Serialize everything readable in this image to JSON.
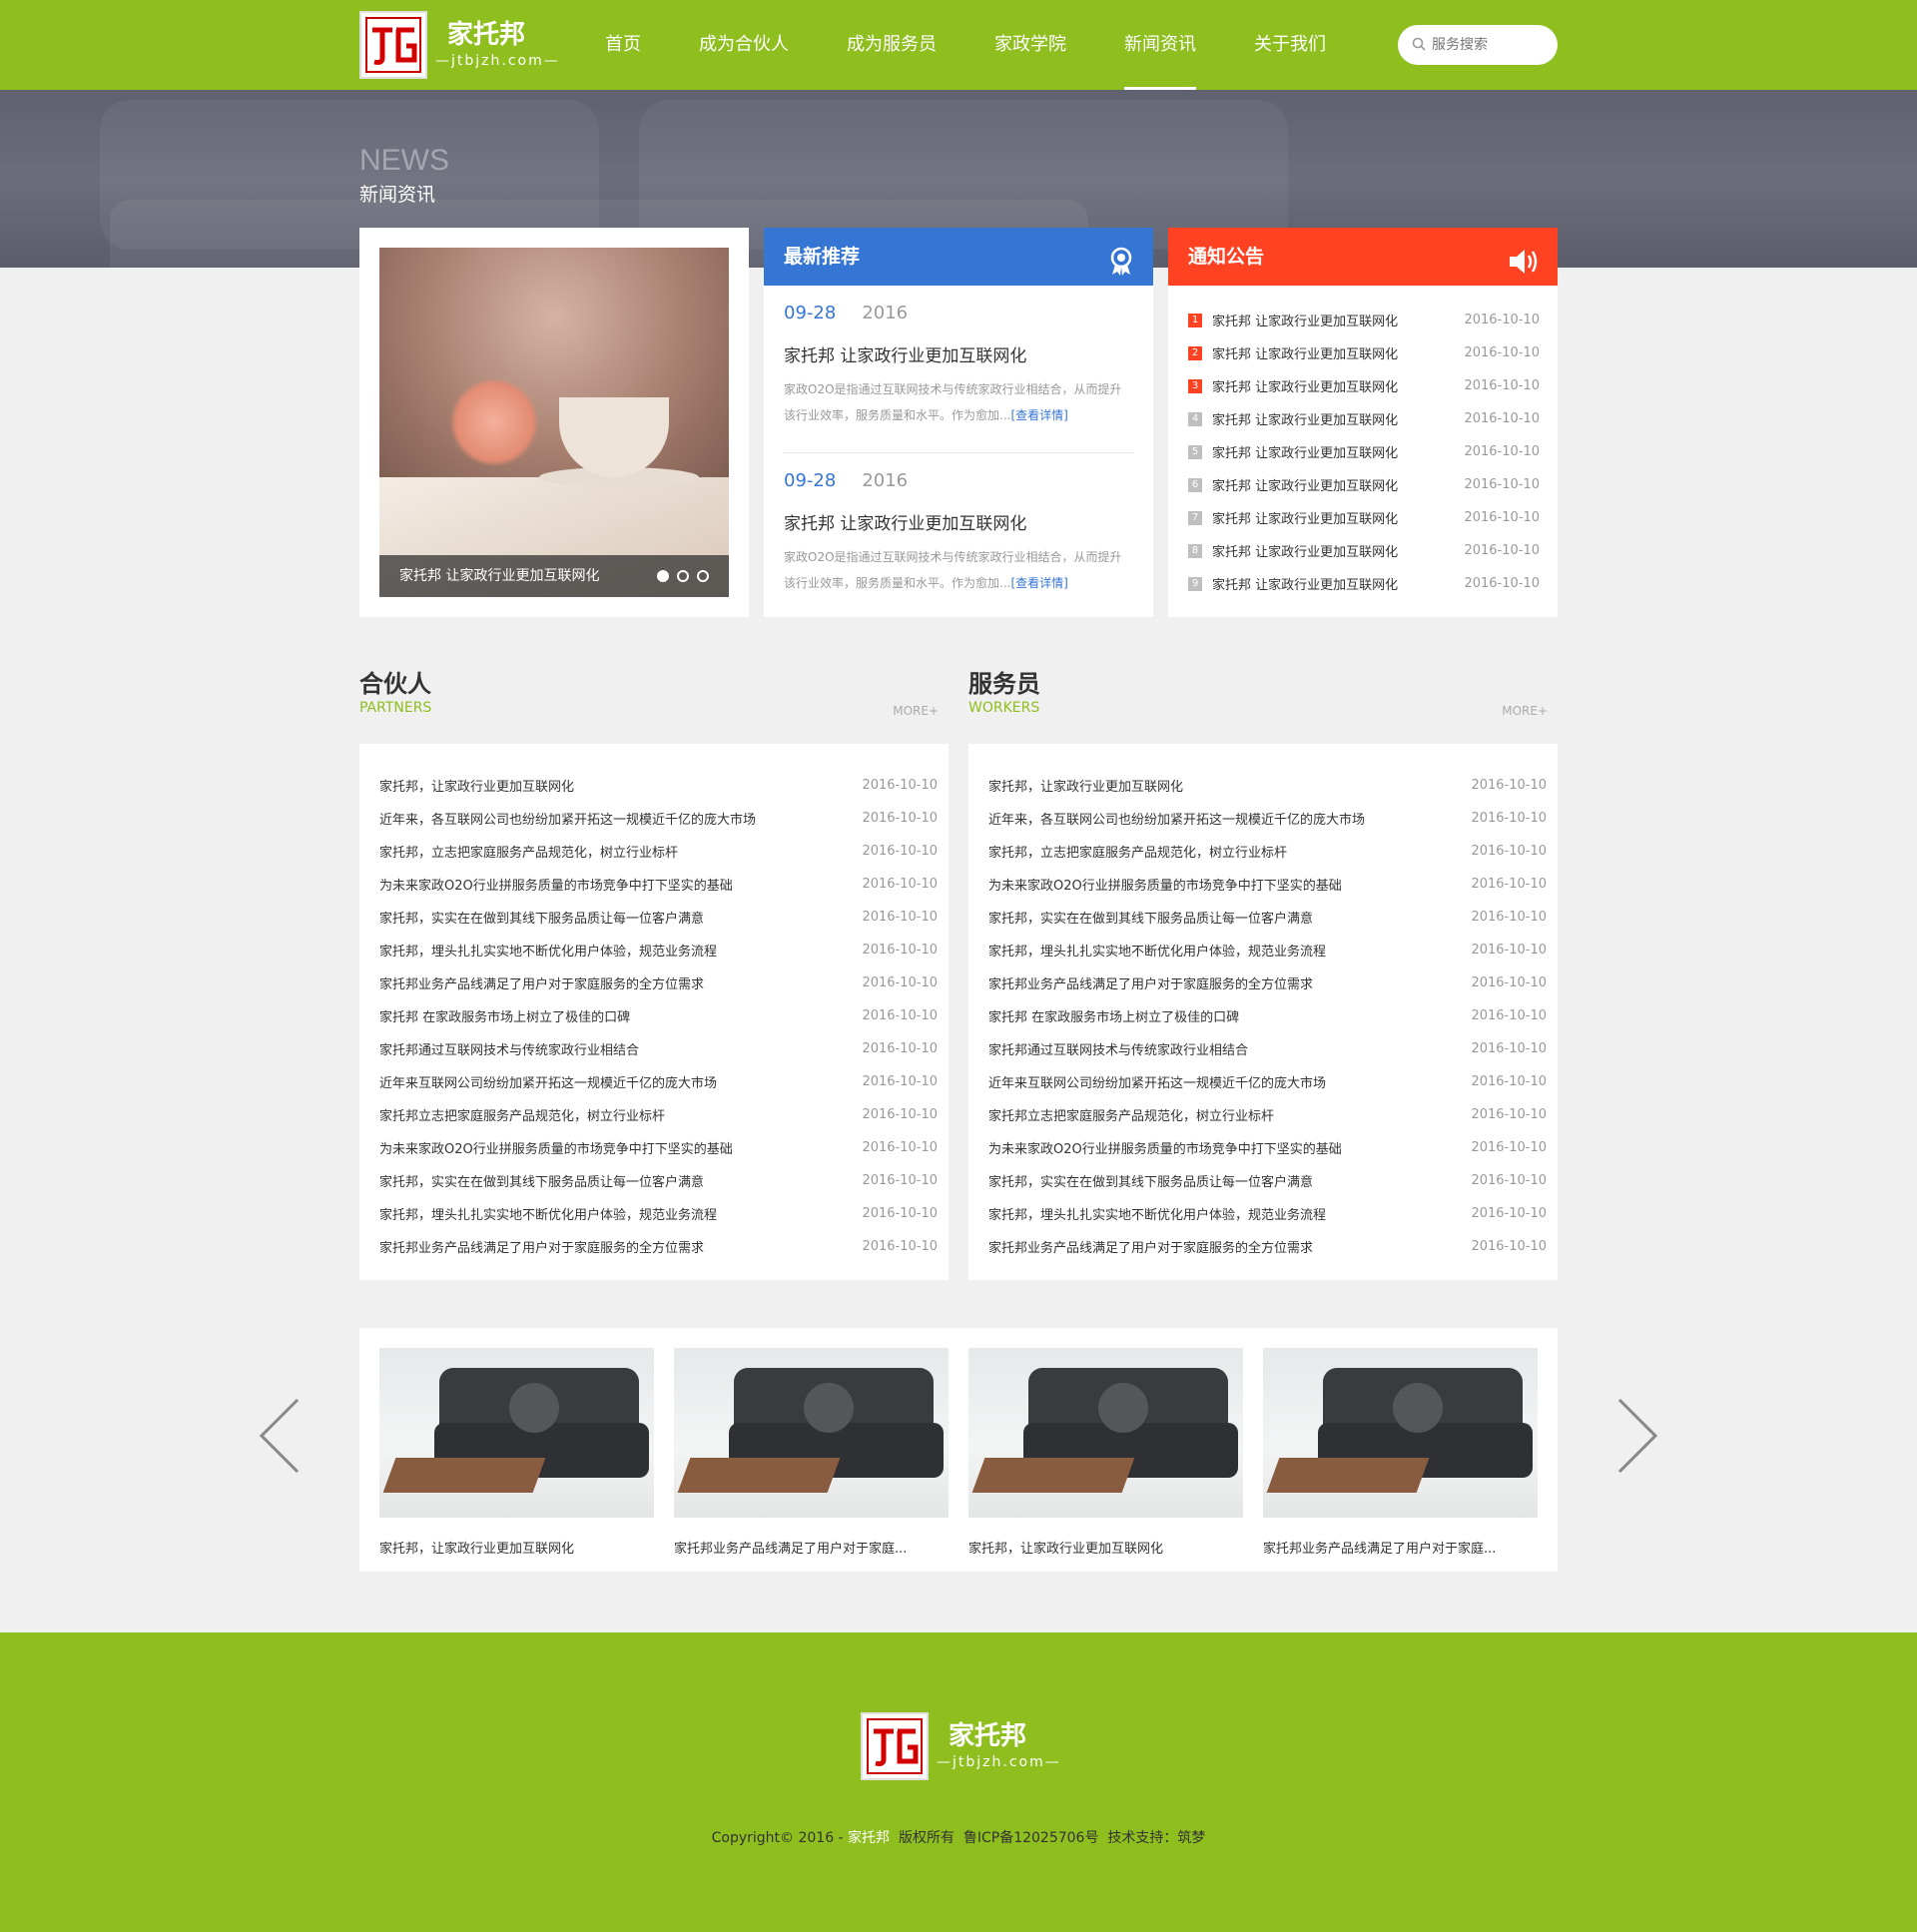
{
  "colors": {
    "green": "#8fbe1f",
    "blue": "#3575d3",
    "red": "#ff4322"
  },
  "brand": {
    "name": "家托邦",
    "domain": "—jtbjzh.com—"
  },
  "nav": {
    "items": [
      "首页",
      "成为合伙人",
      "成为服务员",
      "家政学院",
      "新闻资讯",
      "关于我们"
    ],
    "active": "新闻资讯"
  },
  "search": {
    "placeholder": "服务搜索",
    "icon": "search-icon"
  },
  "banner": {
    "en": "NEWS",
    "cn": "新闻资讯"
  },
  "slider": {
    "caption": "家托邦 让家政行业更加互联网化",
    "slides": 3,
    "active": 1
  },
  "latest": {
    "title": "最新推荐",
    "icon": "award-ribbon-icon",
    "items": [
      {
        "md": "09-28",
        "year": "2016",
        "title": "家托邦 让家政行业更加互联网化",
        "desc": "家政O2O是指通过互联网技术与传统家政行业相结合，从而提升该行业效率，服务质量和水平。作为愈加...",
        "more": "[查看详情]"
      },
      {
        "md": "09-28",
        "year": "2016",
        "title": "家托邦 让家政行业更加互联网化",
        "desc": "家政O2O是指通过互联网技术与传统家政行业相结合，从而提升该行业效率，服务质量和水平。作为愈加...",
        "more": "[查看详情]"
      }
    ]
  },
  "notice": {
    "title": "通知公告",
    "icon": "speaker-icon",
    "items": [
      {
        "n": "1",
        "title": "家托邦 让家政行业更加互联网化",
        "date": "2016-10-10"
      },
      {
        "n": "2",
        "title": "家托邦 让家政行业更加互联网化",
        "date": "2016-10-10"
      },
      {
        "n": "3",
        "title": "家托邦 让家政行业更加互联网化",
        "date": "2016-10-10"
      },
      {
        "n": "4",
        "title": "家托邦 让家政行业更加互联网化",
        "date": "2016-10-10"
      },
      {
        "n": "5",
        "title": "家托邦 让家政行业更加互联网化",
        "date": "2016-10-10"
      },
      {
        "n": "6",
        "title": "家托邦 让家政行业更加互联网化",
        "date": "2016-10-10"
      },
      {
        "n": "7",
        "title": "家托邦 让家政行业更加互联网化",
        "date": "2016-10-10"
      },
      {
        "n": "8",
        "title": "家托邦 让家政行业更加互联网化",
        "date": "2016-10-10"
      },
      {
        "n": "9",
        "title": "家托邦 让家政行业更加互联网化",
        "date": "2016-10-10"
      }
    ]
  },
  "partners": {
    "title": "合伙人",
    "en": "PARTNERS",
    "more": "MORE+",
    "items": [
      {
        "title": "家托邦，让家政行业更加互联网化",
        "date": "2016-10-10"
      },
      {
        "title": "近年来，各互联网公司也纷纷加紧开拓这一规模近千亿的庞大市场",
        "date": "2016-10-10"
      },
      {
        "title": "家托邦，立志把家庭服务产品规范化，树立行业标杆",
        "date": "2016-10-10"
      },
      {
        "title": "为未来家政O2O行业拼服务质量的市场竞争中打下坚实的基础",
        "date": "2016-10-10"
      },
      {
        "title": "家托邦，实实在在做到其线下服务品质让每一位客户满意",
        "date": "2016-10-10"
      },
      {
        "title": "家托邦，埋头扎扎实实地不断优化用户体验，规范业务流程",
        "date": "2016-10-10"
      },
      {
        "title": "家托邦业务产品线满足了用户对于家庭服务的全方位需求",
        "date": "2016-10-10"
      },
      {
        "title": "家托邦 在家政服务市场上树立了极佳的口碑",
        "date": "2016-10-10"
      },
      {
        "title": "家托邦通过互联网技术与传统家政行业相结合",
        "date": "2016-10-10"
      },
      {
        "title": "近年来互联网公司纷纷加紧开拓这一规模近千亿的庞大市场",
        "date": "2016-10-10"
      },
      {
        "title": "家托邦立志把家庭服务产品规范化，树立行业标杆",
        "date": "2016-10-10"
      },
      {
        "title": "为未来家政O2O行业拼服务质量的市场竞争中打下坚实的基础",
        "date": "2016-10-10"
      },
      {
        "title": "家托邦，实实在在做到其线下服务品质让每一位客户满意",
        "date": "2016-10-10"
      },
      {
        "title": "家托邦，埋头扎扎实实地不断优化用户体验，规范业务流程",
        "date": "2016-10-10"
      },
      {
        "title": "家托邦业务产品线满足了用户对于家庭服务的全方位需求",
        "date": "2016-10-10"
      }
    ]
  },
  "workers": {
    "title": "服务员",
    "en": "WORKERS",
    "more": "MORE+",
    "items": [
      {
        "title": "家托邦，让家政行业更加互联网化",
        "date": "2016-10-10"
      },
      {
        "title": "近年来，各互联网公司也纷纷加紧开拓这一规模近千亿的庞大市场",
        "date": "2016-10-10"
      },
      {
        "title": "家托邦，立志把家庭服务产品规范化，树立行业标杆",
        "date": "2016-10-10"
      },
      {
        "title": "为未来家政O2O行业拼服务质量的市场竞争中打下坚实的基础",
        "date": "2016-10-10"
      },
      {
        "title": "家托邦，实实在在做到其线下服务品质让每一位客户满意",
        "date": "2016-10-10"
      },
      {
        "title": "家托邦，埋头扎扎实实地不断优化用户体验，规范业务流程",
        "date": "2016-10-10"
      },
      {
        "title": "家托邦业务产品线满足了用户对于家庭服务的全方位需求",
        "date": "2016-10-10"
      },
      {
        "title": "家托邦 在家政服务市场上树立了极佳的口碑",
        "date": "2016-10-10"
      },
      {
        "title": "家托邦通过互联网技术与传统家政行业相结合",
        "date": "2016-10-10"
      },
      {
        "title": "近年来互联网公司纷纷加紧开拓这一规模近千亿的庞大市场",
        "date": "2016-10-10"
      },
      {
        "title": "家托邦立志把家庭服务产品规范化，树立行业标杆",
        "date": "2016-10-10"
      },
      {
        "title": "为未来家政O2O行业拼服务质量的市场竞争中打下坚实的基础",
        "date": "2016-10-10"
      },
      {
        "title": "家托邦，实实在在做到其线下服务品质让每一位客户满意",
        "date": "2016-10-10"
      },
      {
        "title": "家托邦，埋头扎扎实实地不断优化用户体验，规范业务流程",
        "date": "2016-10-10"
      },
      {
        "title": "家托邦业务产品线满足了用户对于家庭服务的全方位需求",
        "date": "2016-10-10"
      }
    ]
  },
  "gallery": {
    "items": [
      {
        "caption": "家托邦，让家政行业更加互联网化"
      },
      {
        "caption": "家托邦业务产品线满足了用户对于家庭..."
      },
      {
        "caption": "家托邦，让家政行业更加互联网化"
      },
      {
        "caption": "家托邦业务产品线满足了用户对于家庭..."
      }
    ]
  },
  "footer": {
    "copy_prefix": "Copyright© 2016 - ",
    "copy_brand": "家托邦",
    "copy_suffix": "  版权所有  鲁ICP备12025706号  技术支持：筑梦"
  }
}
